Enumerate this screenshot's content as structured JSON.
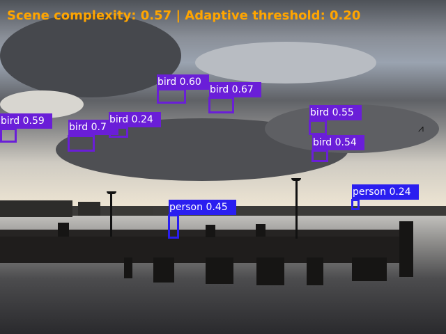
{
  "header": {
    "text": "Scene complexity: 0.57 | Adaptive threshold: 0.20"
  },
  "colors": {
    "title": "#ffa500",
    "bird": "#6a1ed8",
    "person": "#2a1ef0"
  },
  "detections": [
    {
      "label": "bird 0.59",
      "class": "bird",
      "score": 0.59
    },
    {
      "label": "bird 0.7",
      "class": "bird",
      "score": 0.7
    },
    {
      "label": "bird 0.24",
      "class": "bird",
      "score": 0.24
    },
    {
      "label": "bird 0.60",
      "class": "bird",
      "score": 0.6
    },
    {
      "label": "bird 0.67",
      "class": "bird",
      "score": 0.67
    },
    {
      "label": "bird 0.55",
      "class": "bird",
      "score": 0.55
    },
    {
      "label": "bird 0.54",
      "class": "bird",
      "score": 0.54
    },
    {
      "label": "person 0.45",
      "class": "person",
      "score": 0.45
    },
    {
      "label": "person 0.24",
      "class": "person",
      "score": 0.24
    }
  ]
}
